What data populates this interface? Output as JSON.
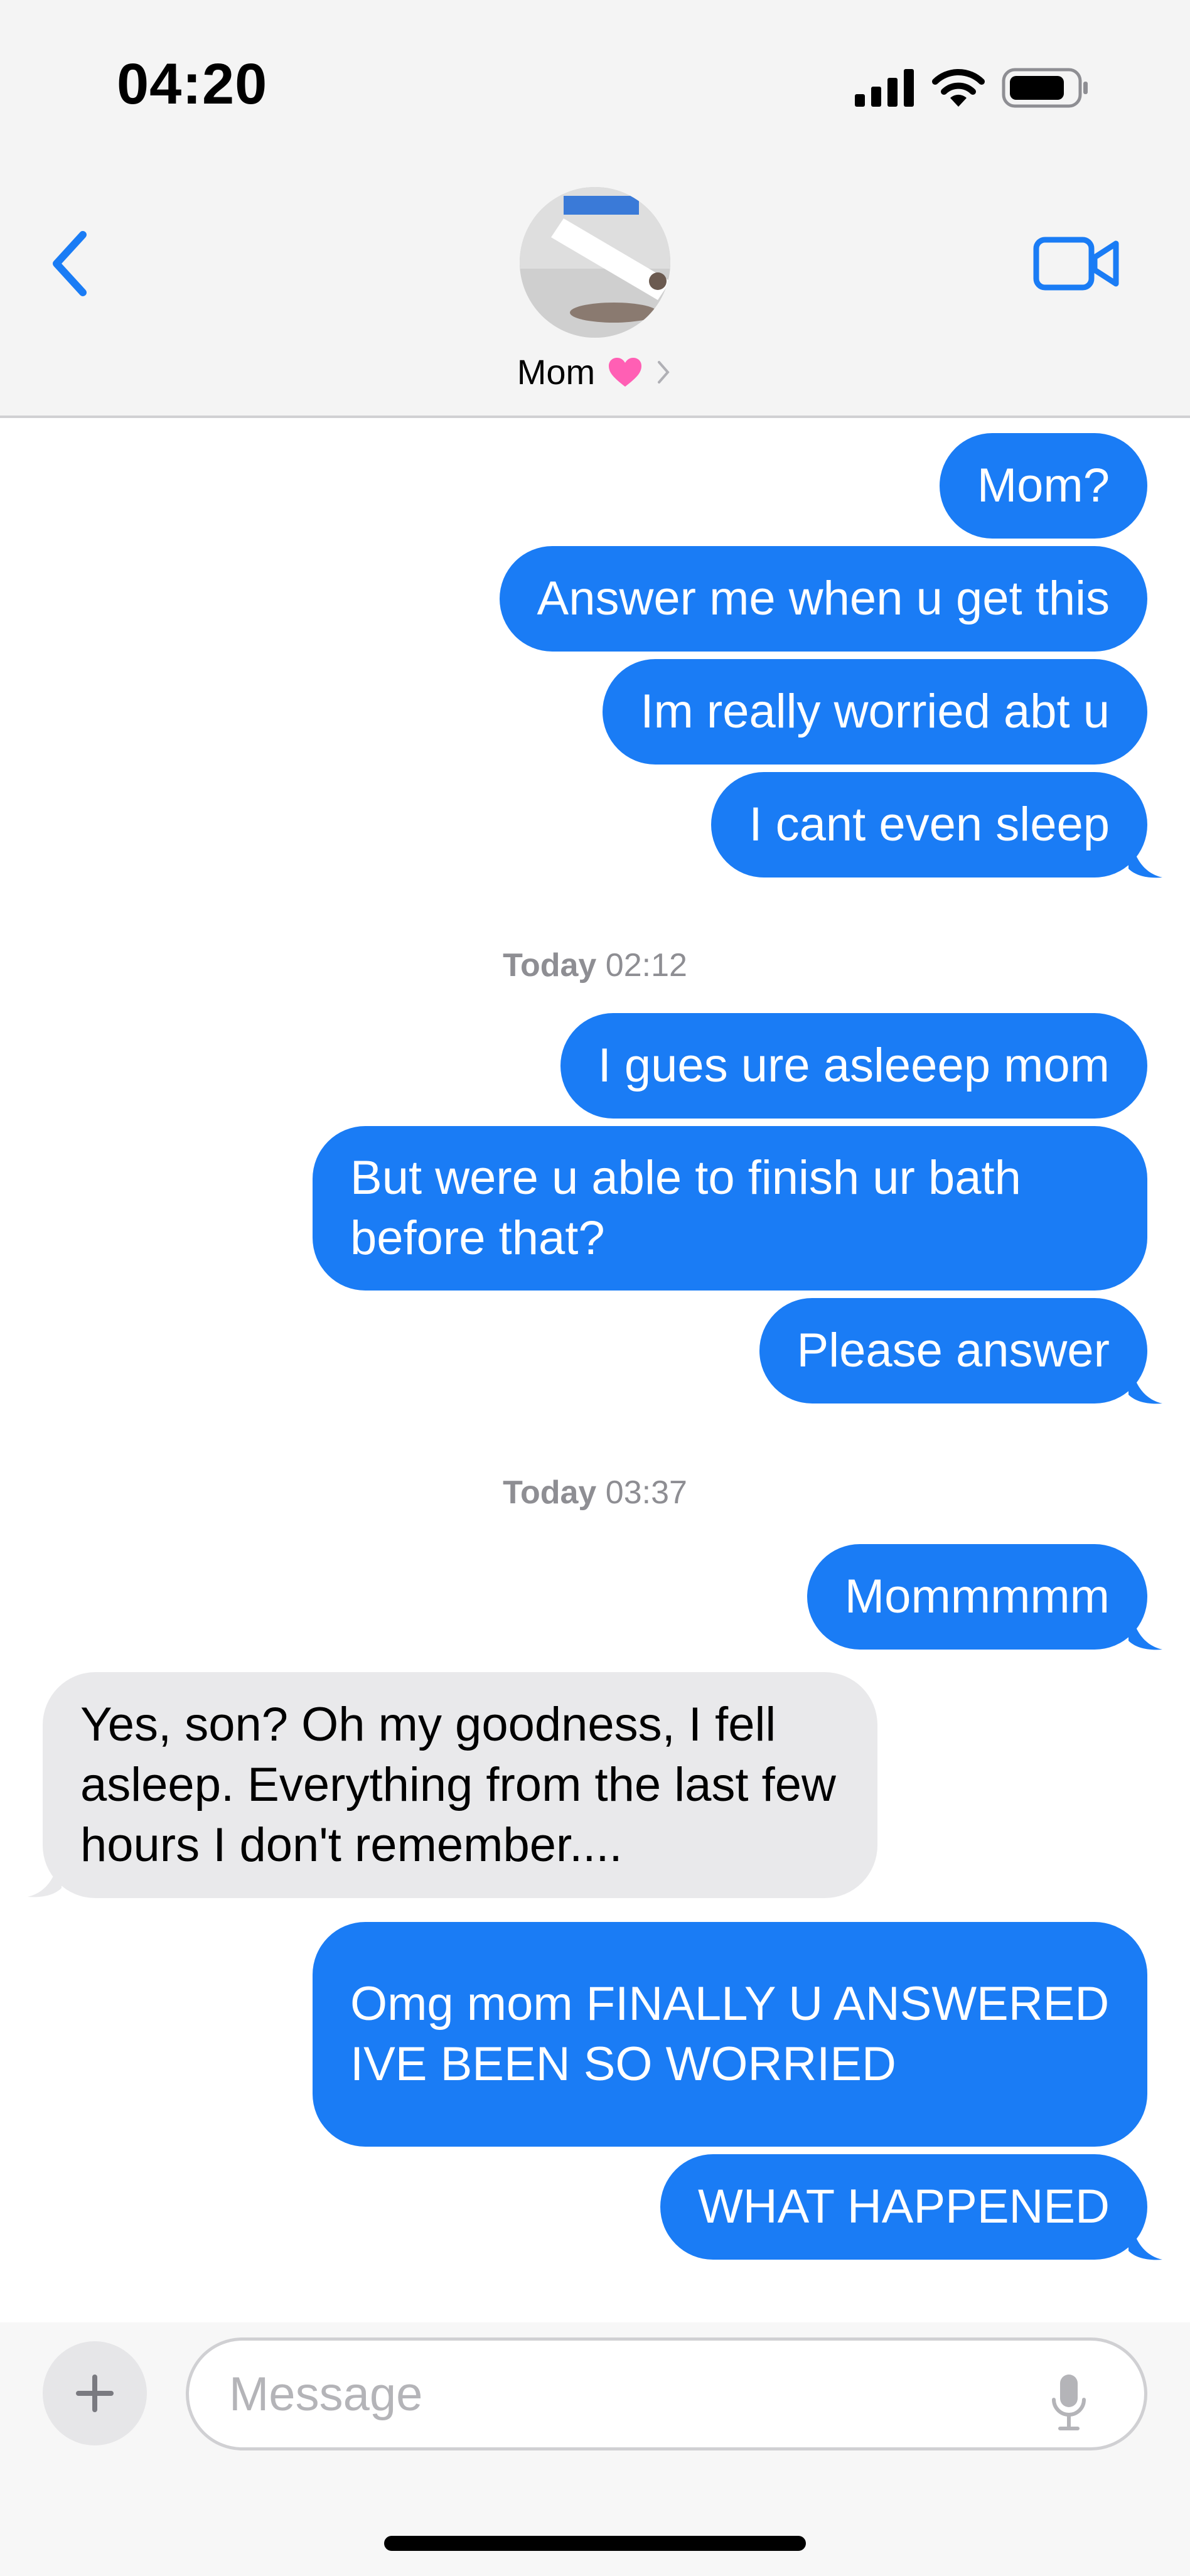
{
  "status_bar": {
    "time": "04:20"
  },
  "header": {
    "contact_name": "Mom",
    "contact_emoji": "pink-heart"
  },
  "colors": {
    "outgoing": "#1a7cf5",
    "incoming": "#e9e9eb",
    "accent": "#1a7cf5",
    "heart": "#ff5fb4"
  },
  "messages": [
    {
      "dir": "out",
      "text": "Mom?"
    },
    {
      "dir": "out",
      "text": "Answer me when u get this"
    },
    {
      "dir": "out",
      "text": "Im really worried abt u"
    },
    {
      "dir": "out",
      "text": "I cant even sleep"
    },
    {
      "stamp_day": "Today",
      "stamp_time": "02:12"
    },
    {
      "dir": "out",
      "text": "I gues ure asleeep mom"
    },
    {
      "dir": "out",
      "text": "But were u able to finish ur bath before that?"
    },
    {
      "dir": "out",
      "text": "Please answer"
    },
    {
      "stamp_day": "Today",
      "stamp_time": "03:37"
    },
    {
      "dir": "out",
      "text": "Mommmmm"
    },
    {
      "dir": "in",
      "text": "Yes, son? Oh my goodness, I fell asleep. Everything from the last few hours I don't remember...."
    },
    {
      "dir": "out",
      "text": "Omg mom FINALLY U ANSWERED IVE BEEN SO WORRIED"
    },
    {
      "dir": "out",
      "text": "WHAT HAPPENED"
    }
  ],
  "composer": {
    "placeholder": "Message"
  }
}
